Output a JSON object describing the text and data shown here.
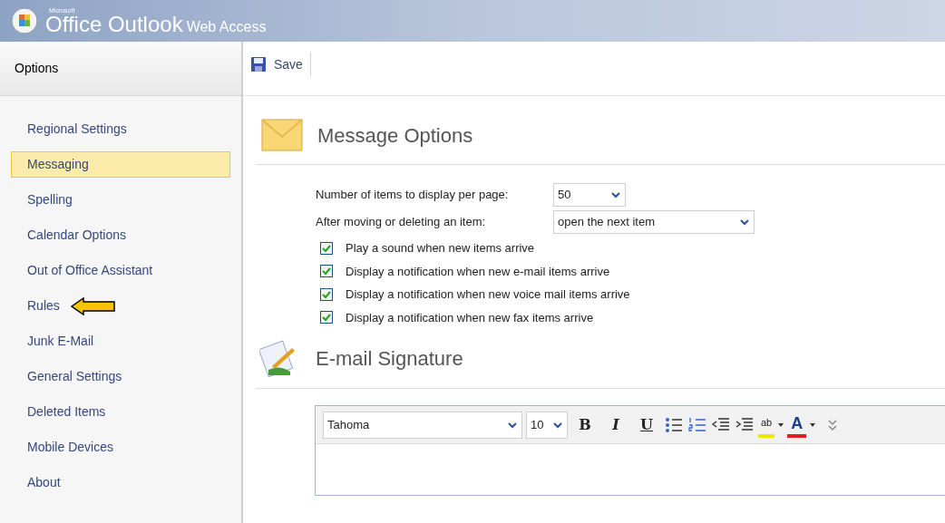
{
  "header": {
    "brand_small": "Microsoft",
    "brand": "Office Outlook",
    "brand_suffix": "Web Access"
  },
  "sidebar": {
    "title": "Options",
    "items": [
      {
        "label": "Regional Settings",
        "selected": false
      },
      {
        "label": "Messaging",
        "selected": true
      },
      {
        "label": "Spelling",
        "selected": false
      },
      {
        "label": "Calendar Options",
        "selected": false
      },
      {
        "label": "Out of Office Assistant",
        "selected": false
      },
      {
        "label": "Rules",
        "selected": false,
        "pointer": true
      },
      {
        "label": "Junk E-Mail",
        "selected": false
      },
      {
        "label": "General Settings",
        "selected": false
      },
      {
        "label": "Deleted Items",
        "selected": false
      },
      {
        "label": "Mobile Devices",
        "selected": false
      },
      {
        "label": "About",
        "selected": false
      }
    ]
  },
  "toolbar": {
    "save": "Save"
  },
  "message_options": {
    "title": "Message Options",
    "fields": [
      {
        "label": "Number of items to display per page:",
        "value": "50"
      },
      {
        "label": "After moving or deleting an item:",
        "value": "open the next item"
      }
    ],
    "checkboxes": [
      {
        "label": "Play a sound when new items arrive",
        "checked": true
      },
      {
        "label": "Display a notification when new e-mail items arrive",
        "checked": true
      },
      {
        "label": "Display a notification when new voice mail items arrive",
        "checked": true
      },
      {
        "label": "Display a notification when new fax items arrive",
        "checked": true
      }
    ]
  },
  "signature": {
    "title": "E-mail Signature",
    "font": "Tahoma",
    "size": "10",
    "format_buttons": [
      {
        "kind": "bold",
        "label": "B"
      },
      {
        "kind": "italic",
        "label": "I"
      },
      {
        "kind": "underline",
        "label": "U"
      }
    ],
    "highlight": "ab",
    "font_color": "A"
  }
}
